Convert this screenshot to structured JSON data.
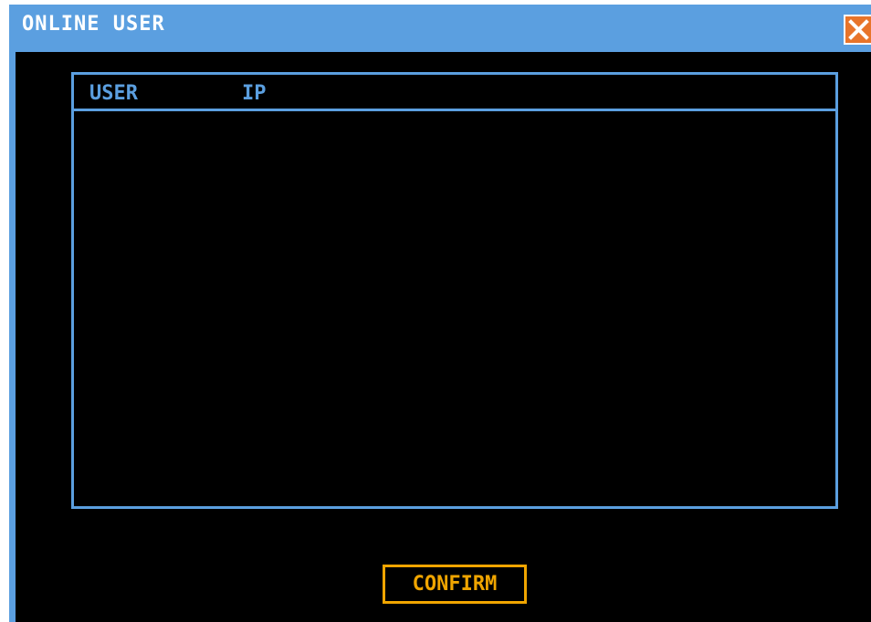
{
  "dialog": {
    "title": "ONLINE USER",
    "close_icon": "close-icon"
  },
  "table": {
    "columns": [
      "USER",
      "IP"
    ],
    "rows": []
  },
  "actions": {
    "confirm_label": "CONFIRM"
  },
  "colors": {
    "title_bar": "#5b9fe0",
    "background": "#000000",
    "accent_border": "#5b9fe0",
    "confirm_accent": "#f0a500",
    "close_button": "#e8742a"
  }
}
